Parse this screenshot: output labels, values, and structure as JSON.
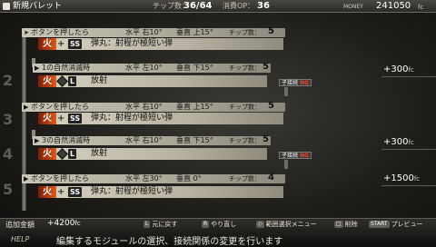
{
  "header": {
    "title": "新規バレット",
    "chip_label": "チップ数：",
    "chip_value": "36/64",
    "consume_label": "消費OP：",
    "consume_value": "36",
    "money_label": "MONEY",
    "money_value": "241050",
    "money_unit": "fc"
  },
  "row_numbers": [
    "2",
    "3",
    "4",
    "5"
  ],
  "rows": [
    {
      "condition": "ボタンを押したら",
      "horizontal": "水平 右10°",
      "vertical": "垂直 上15°",
      "chip_label": "チップ数：",
      "chip_count": "5",
      "element": "火",
      "size_badge": "SS",
      "description": "弾丸：射程が極短い弾"
    },
    {
      "condition": "1の自然消滅時",
      "horizontal": "水平 左10°",
      "vertical": "垂直 下15°",
      "chip_label": "チップ数：",
      "chip_count": "5",
      "element": "火",
      "size_badge": "L",
      "description": "放射",
      "ng_label": "子接続",
      "ng_value": "NG",
      "cost": "+300",
      "cost_unit": "fc"
    },
    {
      "condition": "ボタンを押したら",
      "horizontal": "水平 右10°",
      "vertical": "垂直 上15°",
      "chip_label": "チップ数：",
      "chip_count": "5",
      "element": "火",
      "size_badge": "SS",
      "description": "弾丸：射程が極短い弾"
    },
    {
      "condition": "3の自然消滅時",
      "horizontal": "水平 右10°",
      "vertical": "垂直 下15°",
      "chip_label": "チップ数：",
      "chip_count": "5",
      "element": "火",
      "size_badge": "L",
      "description": "放射",
      "ng_label": "子接続",
      "ng_value": "NG",
      "cost": "+300",
      "cost_unit": "fc"
    },
    {
      "condition": "ボタンを押したら",
      "horizontal": "水平 左30°",
      "vertical": "垂直 0°",
      "chip_label": "チップ数：",
      "chip_count": "4",
      "element": "火",
      "size_badge": "SS",
      "description": "弾丸：射程が極短い弾",
      "cost": "+1500",
      "cost_unit": "fc"
    }
  ],
  "footer": {
    "add_label": "追加金額",
    "add_value": "+4200",
    "add_unit": "fc",
    "controls": [
      {
        "key": "L",
        "label": "元に戻す"
      },
      {
        "key": "R",
        "label": "やり直し"
      },
      {
        "key": "◇",
        "label": "範囲選択メニュー"
      },
      {
        "key": "□",
        "label": "削除"
      },
      {
        "key": "START",
        "label": "プレビュー"
      }
    ],
    "help_label": "HELP",
    "help_text": "編集するモジュールの選択、接続関係の変更を行います"
  },
  "colors": {
    "fire_element": "#e05a17",
    "ng_red": "#ff4030",
    "panel_light": "#d7d2c0"
  }
}
